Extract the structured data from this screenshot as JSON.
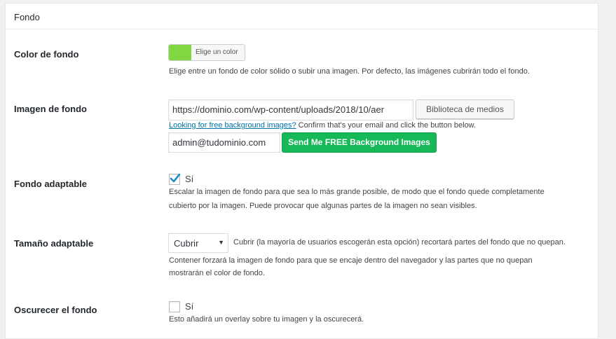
{
  "section": {
    "title": "Fondo"
  },
  "color": {
    "label": "Color de fondo",
    "button_label": "Elige un color",
    "swatch": "#81d742",
    "description": "Elige entre un fondo de color sólido o subir una imagen. Por defecto, las imágenes cubrirán todo el fondo."
  },
  "image": {
    "label": "Imagen de fondo",
    "url_value": "https://dominio.com/wp-content/uploads/2018/10/aer",
    "library_button": "Biblioteca de medios",
    "free_link": "Looking for free background images?",
    "free_note": " Confirm that's your email and click the button below.",
    "email_value": "admin@tudominio.com",
    "send_button": "Send Me FREE Background Images"
  },
  "responsive": {
    "label": "Fondo adaptable",
    "checkbox_label": "Sí",
    "checked": true,
    "description_line1": "Escalar la imagen de fondo para que sea lo más grande posible, de modo que el fondo quede completamente",
    "description_line2": "cubierto por la imagen. Puede provocar que algunas partes de la imagen no sean visibles."
  },
  "size": {
    "label": "Tamaño adaptable",
    "selected": "Cubrir",
    "inline_note": "Cubrir (la mayoría de usuarios escogerán esta opción) recortará partes del fondo que no quepan.",
    "description_line1": "Contener forzará la imagen de fondo para que se encaje dentro del navegador y las partes que no quepan",
    "description_line2": "mostrarán el color de fondo."
  },
  "darken": {
    "label": "Oscurecer el fondo",
    "checkbox_label": "Sí",
    "checked": false,
    "description": "Esto añadirá un overlay sobre tu imagen y la oscurecerá."
  }
}
